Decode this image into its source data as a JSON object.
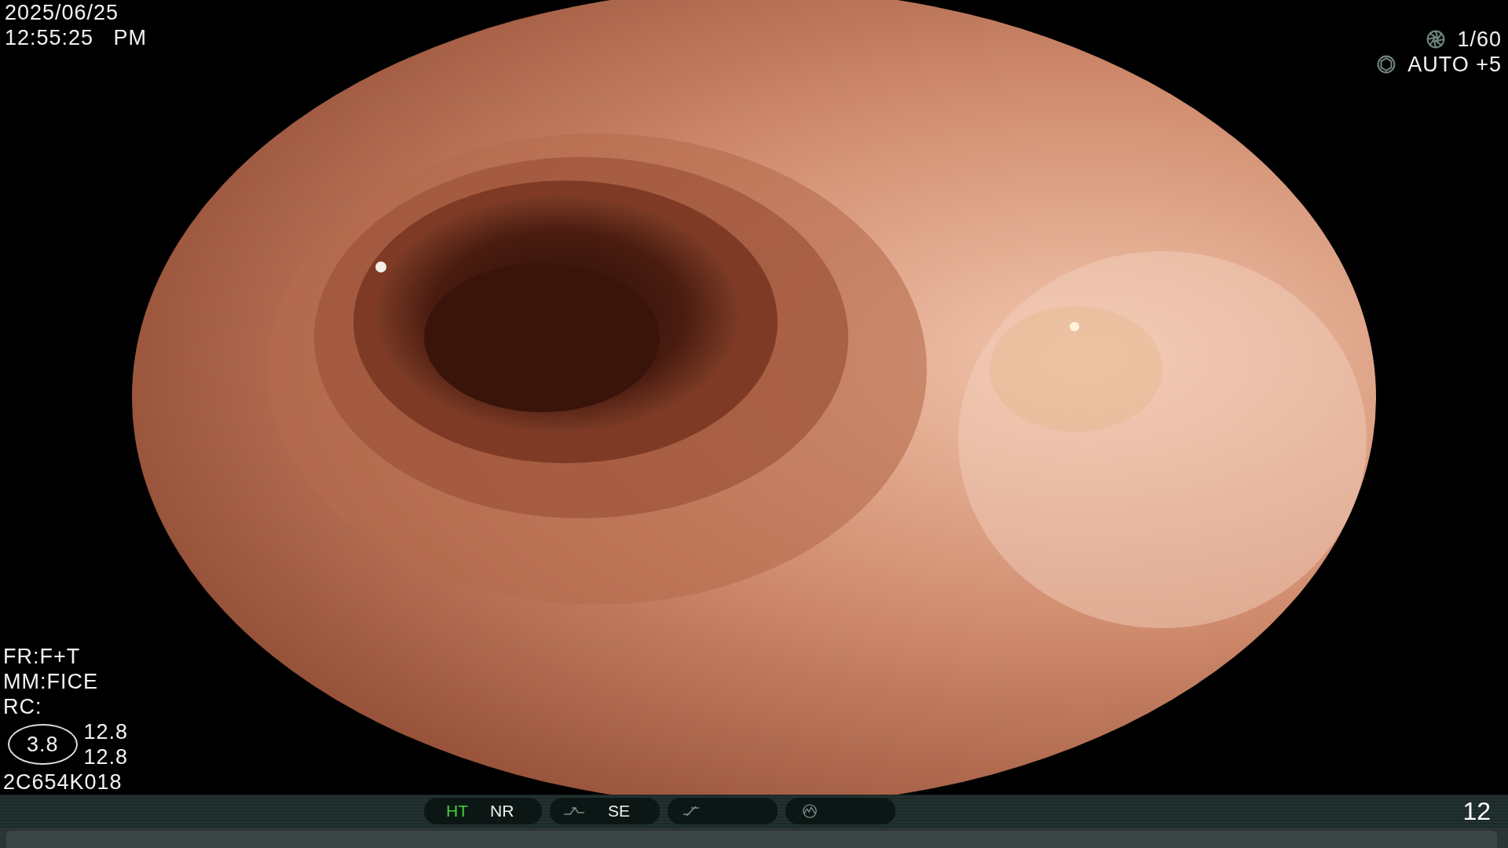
{
  "datetime": {
    "date": "2025/06/25",
    "time": "12:55:25   PM"
  },
  "exposure": {
    "shutter": "1/60",
    "iris": "AUTO +5"
  },
  "settings": [
    "FR:F+T",
    "MM:FICE",
    "RC:"
  ],
  "zoom": {
    "value": "3.8",
    "readings": [
      "12.8",
      "12.8"
    ]
  },
  "scope_id": "2C654K018",
  "status_bar": {
    "groups": [
      {
        "kind": "text",
        "items": [
          {
            "label": "HT",
            "active": true
          },
          {
            "label": "NR",
            "active": false
          }
        ]
      },
      {
        "kind": "curve",
        "items": [
          {
            "label": "SE",
            "active": false
          }
        ]
      },
      {
        "kind": "slash"
      },
      {
        "kind": "waveform"
      }
    ],
    "counter": "12"
  }
}
